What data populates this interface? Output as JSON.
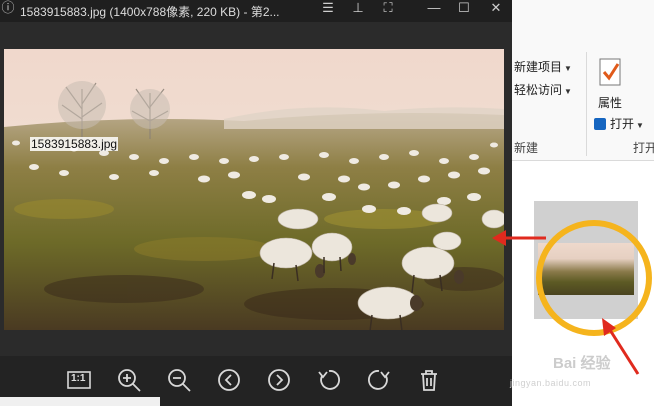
{
  "viewer": {
    "title": "1583915883.jpg (1400x788像素, 220 KB) - 第2...",
    "toolbar": {
      "actual_size_label": "1:1",
      "zoom_in": "zoom-in-icon",
      "zoom_out": "zoom-out-icon",
      "prev": "chevron-left-icon",
      "next": "chevron-right-icon",
      "rotate_left": "rotate-left-icon",
      "rotate_right": "rotate-right-icon",
      "delete": "trash-icon"
    }
  },
  "explorer": {
    "ribbon": {
      "new_item": "新建项目",
      "easy_access": "轻松访问",
      "properties": "属性",
      "open": "打开",
      "group_new": "新建",
      "group_open": "打开"
    },
    "file": {
      "name": "1583915883.jpg"
    }
  },
  "watermark": {
    "brand": "Bai 经验",
    "sub": "jingyan.baidu.com"
  },
  "colors": {
    "highlight_circle": "#f5b41d",
    "arrow": "#e02a1e",
    "viewer_bg": "#2b2b2b"
  }
}
